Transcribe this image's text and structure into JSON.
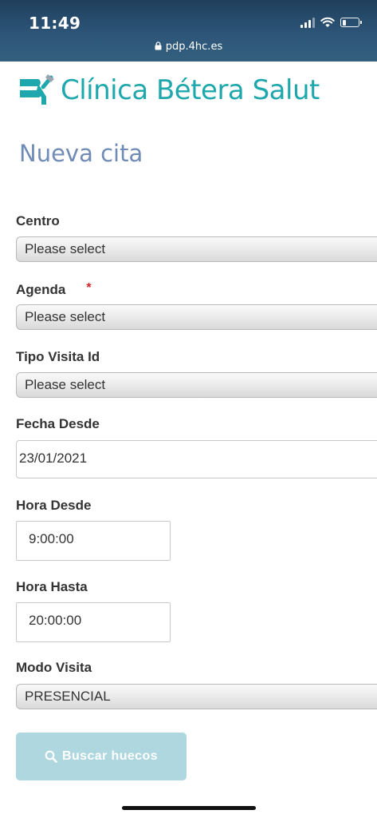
{
  "status_bar": {
    "time": "11:49",
    "url": "pdp.4hc.es",
    "icons": [
      "signal-icon",
      "wifi-icon",
      "battery-icon"
    ]
  },
  "brand": {
    "name": "Clínica Bétera Salut",
    "color": "#1ea8ad"
  },
  "page": {
    "title": "Nueva cita",
    "title_color": "#6f8bb6"
  },
  "form": {
    "centro": {
      "label": "Centro",
      "value": "Please select"
    },
    "agenda": {
      "label": "Agenda",
      "required_mark": "*",
      "value": "Please select"
    },
    "tipo_visita": {
      "label": "Tipo Visita Id",
      "value": "Please select"
    },
    "fecha_desde": {
      "label": "Fecha Desde",
      "value": "23/01/2021"
    },
    "hora_desde": {
      "label": "Hora Desde",
      "value": "9:00:00"
    },
    "hora_hasta": {
      "label": "Hora Hasta",
      "value": "20:00:00"
    },
    "modo_visita": {
      "label": "Modo Visita",
      "value": "PRESENCIAL"
    }
  },
  "actions": {
    "search_label": "Buscar huecos",
    "search_color": "#aed7df"
  }
}
